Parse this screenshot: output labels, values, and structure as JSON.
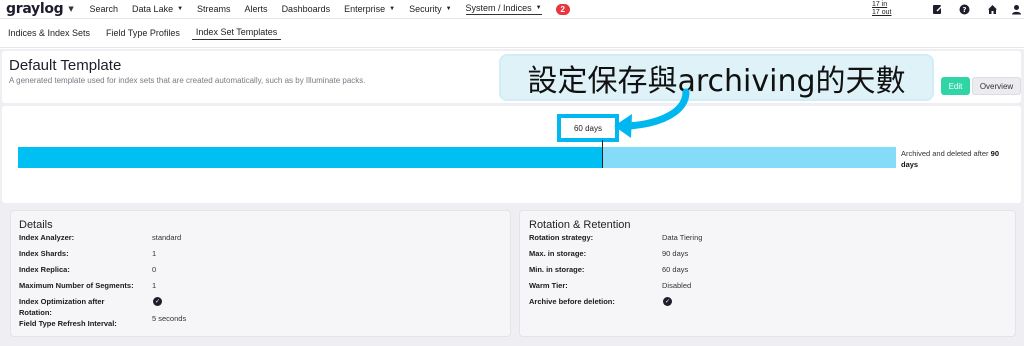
{
  "logo": "graylog",
  "nav": {
    "search": "Search",
    "data_lake": "Data Lake",
    "streams": "Streams",
    "alerts": "Alerts",
    "dashboards": "Dashboards",
    "enterprise": "Enterprise",
    "security": "Security",
    "system": "System / Indices",
    "badge": "2",
    "throughput_in": "17 in",
    "throughput_out": "17 out"
  },
  "icons": {
    "notebook": "notebook-icon",
    "help": "help-icon",
    "home": "home-icon",
    "user": "user-icon"
  },
  "subnav": {
    "indices": "Indices & Index Sets",
    "field_types": "Field Type Profiles",
    "templates": "Index Set Templates"
  },
  "header": {
    "title": "Default Template",
    "description": "A generated template used for index sets that are created automatically, such as by Illuminate packs.",
    "edit": "Edit",
    "overview": "Overview"
  },
  "annotation": "設定保存與archiving的天數",
  "tiering": {
    "hot_label": "60 days",
    "hot_days": 60,
    "total_days": 90,
    "archived_prefix": "Archived and deleted after ",
    "archived_days": "90",
    "archived_suffix": "days",
    "hot_color": "#00bff3",
    "warm_color": "#85dcf9"
  },
  "details": {
    "title": "Details",
    "rows": [
      {
        "label": "Index Analyzer:",
        "value": "standard"
      },
      {
        "label": "Index Shards:",
        "value": "1"
      },
      {
        "label": "Index Replica:",
        "value": "0"
      },
      {
        "label": "Maximum Number of Segments:",
        "value": "1"
      },
      {
        "label": "Index Optimization after",
        "label2": "Rotation:",
        "value": ""
      },
      {
        "label": "Field Type Refresh Interval:",
        "value": "5 seconds"
      }
    ]
  },
  "rotation": {
    "title": "Rotation & Retention",
    "rows": [
      {
        "label": "Rotation strategy:",
        "value": "Data Tiering"
      },
      {
        "label": "Max. in storage:",
        "value": "90 days"
      },
      {
        "label": "Min. in storage:",
        "value": "60 days"
      },
      {
        "label": "Warm Tier:",
        "value": "Disabled"
      },
      {
        "label": "Archive before deletion:",
        "value": ""
      }
    ]
  }
}
